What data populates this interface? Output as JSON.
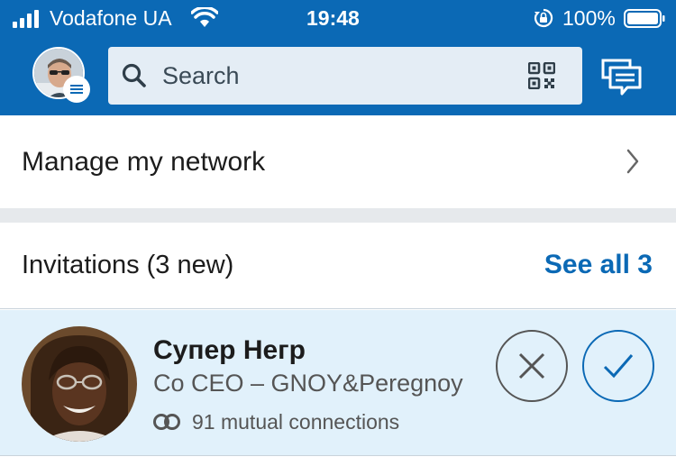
{
  "status_bar": {
    "carrier": "Vodafone UA",
    "time": "19:48",
    "battery": "100%"
  },
  "header": {
    "search": {
      "placeholder": "Search"
    }
  },
  "network": {
    "manage_label": "Manage my network"
  },
  "invitations": {
    "header": "Invitations (3 new)",
    "see_all": "See all 3",
    "items": [
      {
        "name": "Супер Негр",
        "title": "Co CEO – GNOY&Peregnoy",
        "mutual": "91 mutual connections"
      }
    ]
  },
  "colors": {
    "brand": "#0b69b5",
    "invite_bg": "#e1f1fb"
  },
  "icons": [
    "signal-icon",
    "wifi-icon",
    "orientation-lock-icon",
    "battery-icon",
    "menu-icon",
    "search-icon",
    "qr-code-icon",
    "messaging-icon",
    "chevron-right-icon",
    "mutual-connections-icon",
    "close-icon",
    "check-icon"
  ]
}
